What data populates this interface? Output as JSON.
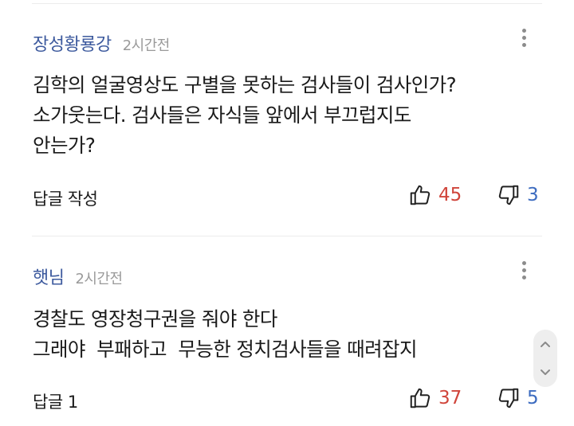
{
  "comments": [
    {
      "author": "장성황룡강",
      "time": "2시간전",
      "lines": [
        "김학의 얼굴영상도 구별을 못하는 검사들이 검사인가?",
        "소가웃는다. 검사들은 자식들 앞에서 부끄럽지도",
        "안는가?"
      ],
      "reply_label": "답글 작성",
      "likes": "45",
      "dislikes": "3"
    },
    {
      "author": "햇님",
      "time": "2시간전",
      "lines": [
        "경찰도 영장청구권을 줘야 한다",
        "그래야  부패하고  무능한 정치검사들을 때려잡지"
      ],
      "reply_label": "답글 1",
      "likes": "37",
      "dislikes": "5"
    }
  ],
  "icons": {
    "more": "more-vertical-icon",
    "like": "thumbs-up-icon",
    "dislike": "thumbs-down-icon",
    "scroll_up": "chevron-up-icon",
    "scroll_down": "chevron-down-icon"
  },
  "colors": {
    "author": "#3d5a9e",
    "like": "#d0453b",
    "dislike": "#3d6cc0",
    "time": "#9a9a9a"
  }
}
